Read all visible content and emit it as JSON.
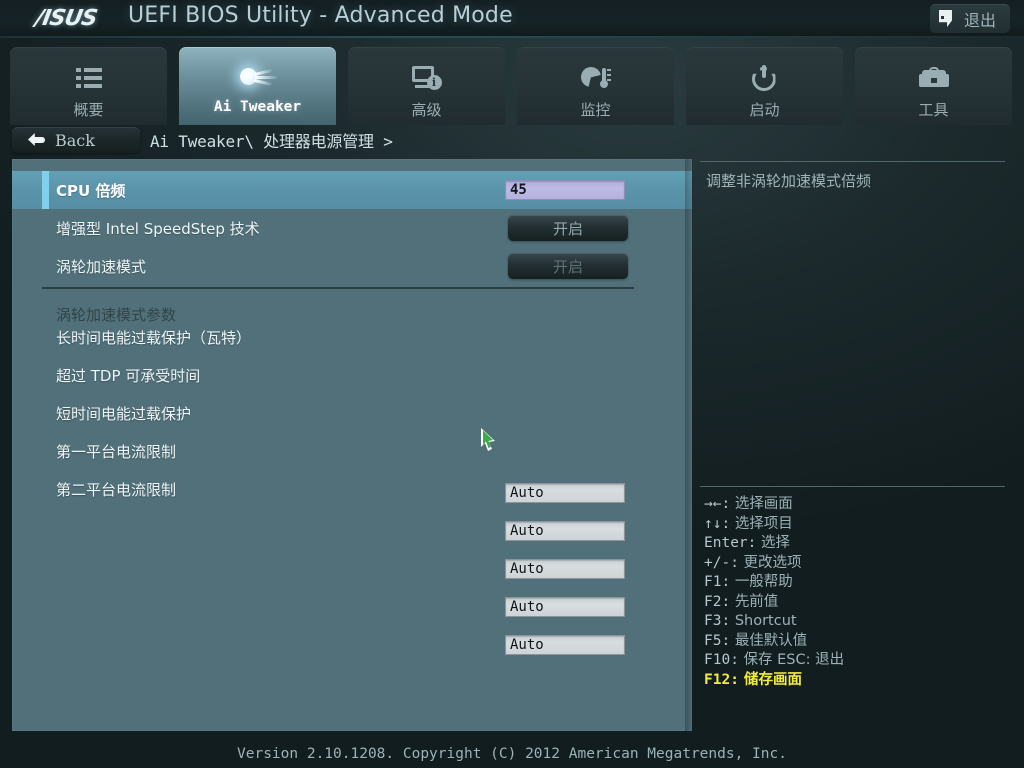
{
  "titlebar": {
    "logo": "/ISUS",
    "title": "UEFI BIOS Utility - Advanced Mode",
    "exit_label": "退出",
    "exit_icon": "exit-door-icon"
  },
  "tabs": [
    {
      "label": "概要",
      "icon": "list-icon",
      "active": false
    },
    {
      "label": "Ai Tweaker",
      "icon": "comet-icon",
      "active": true
    },
    {
      "label": "高级",
      "icon": "monitor-info-icon",
      "active": false
    },
    {
      "label": "监控",
      "icon": "gauge-thermometer-icon",
      "active": false
    },
    {
      "label": "启动",
      "icon": "power-icon",
      "active": false
    },
    {
      "label": "工具",
      "icon": "toolbox-icon",
      "active": false
    }
  ],
  "navbar": {
    "back_label": "Back",
    "back_icon": "back-arrow-icon",
    "breadcrumb": "Ai Tweaker\\ 处理器电源管理 >"
  },
  "settings": [
    {
      "label": "CPU 倍频",
      "value": "45",
      "control": "input-editing",
      "selected": true
    },
    {
      "label": "增强型 Intel SpeedStep 技术",
      "value": "开启",
      "control": "button",
      "selected": false
    },
    {
      "label": "涡轮加速模式",
      "value": "开启",
      "control": "button-dim",
      "selected": false
    }
  ],
  "section": {
    "header": "涡轮加速模式参数",
    "items": [
      {
        "label": "长时间电能过载保护（瓦特）",
        "value": "Auto"
      },
      {
        "label": "超过 TDP 可承受时间",
        "value": "Auto"
      },
      {
        "label": "短时间电能过载保护",
        "value": "Auto"
      },
      {
        "label": "第一平台电流限制",
        "value": "Auto"
      },
      {
        "label": "第二平台电流限制",
        "value": "Auto"
      }
    ]
  },
  "help": {
    "text": "调整非涡轮加速模式倍频"
  },
  "legend": [
    {
      "key": "→←:",
      "desc": "选择画面",
      "highlight": false
    },
    {
      "key": "↑↓:",
      "desc": "选择项目",
      "highlight": false
    },
    {
      "key": "Enter:",
      "desc": "选择",
      "highlight": false
    },
    {
      "key": "+/-:",
      "desc": "更改选项",
      "highlight": false
    },
    {
      "key": "F1:",
      "desc": "一般帮助",
      "highlight": false
    },
    {
      "key": "F2:",
      "desc": "先前值",
      "highlight": false
    },
    {
      "key": "F3:",
      "desc": "Shortcut",
      "highlight": false
    },
    {
      "key": "F5:",
      "desc": "最佳默认值",
      "highlight": false
    },
    {
      "key": "F10:",
      "desc": "保存  ESC: 退出",
      "highlight": false
    },
    {
      "key": "F12:",
      "desc": "储存画面",
      "highlight": true
    }
  ],
  "footer": {
    "text": "Version 2.10.1208. Copyright (C) 2012 American Megatrends, Inc."
  },
  "colors": {
    "panel_bg": "#51707a",
    "selected_row": "#5a93aa",
    "selected_marker": "#7fd0e8",
    "editing_value": "#b4b2dd",
    "legend_highlight": "#f2ec3a",
    "cursor_green": "#3faa4a"
  }
}
